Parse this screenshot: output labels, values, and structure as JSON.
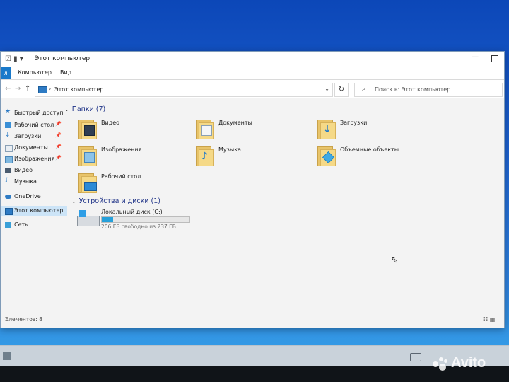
{
  "window": {
    "title": "Этот компьютер",
    "min_glyph": "—"
  },
  "ribbon": {
    "file_tab": "л",
    "tabs": [
      "Компьютер",
      "Вид"
    ]
  },
  "address": {
    "path": "Этот компьютер",
    "search_placeholder": "Поиск в: Этот компьютер"
  },
  "sidebar": {
    "items": [
      {
        "label": "Быстрый доступ",
        "icon": "star-icon",
        "pinned": false
      },
      {
        "label": "Рабочий стол",
        "icon": "desktop-icon",
        "pinned": true
      },
      {
        "label": "Загрузки",
        "icon": "download-icon",
        "pinned": true
      },
      {
        "label": "Документы",
        "icon": "documents-icon",
        "pinned": true
      },
      {
        "label": "Изображения",
        "icon": "pictures-icon",
        "pinned": true
      },
      {
        "label": "Видео",
        "icon": "video-icon",
        "pinned": false
      },
      {
        "label": "Музыка",
        "icon": "music-icon",
        "pinned": false
      },
      {
        "label": "OneDrive",
        "icon": "cloud-icon",
        "pinned": false
      },
      {
        "label": "Этот компьютер",
        "icon": "computer-icon",
        "pinned": false
      },
      {
        "label": "Сеть",
        "icon": "network-icon",
        "pinned": false
      }
    ],
    "selected": "Этот компьютер"
  },
  "folders_group": {
    "title": "Папки (7)",
    "items": [
      {
        "label": "Видео",
        "icon": "video-folder-icon"
      },
      {
        "label": "Документы",
        "icon": "documents-folder-icon"
      },
      {
        "label": "Загрузки",
        "icon": "downloads-folder-icon"
      },
      {
        "label": "Изображения",
        "icon": "pictures-folder-icon"
      },
      {
        "label": "Музыка",
        "icon": "music-folder-icon"
      },
      {
        "label": "Объемные объекты",
        "icon": "3d-objects-folder-icon"
      },
      {
        "label": "Рабочий стол",
        "icon": "desktop-folder-icon"
      }
    ]
  },
  "drives_group": {
    "title": "Устройства и диски (1)",
    "drive": {
      "label": "Локальный диск (C:)",
      "free_text": "206 ГБ свободно из 237 ГБ",
      "used_fraction": 0.13
    }
  },
  "status": {
    "text": "Элементов: 8"
  },
  "watermark": "Avito",
  "colors": {
    "accent": "#1979ca",
    "header_text": "#1e3287",
    "selection": "#cce4f7",
    "drive_bar": "#26a0da"
  }
}
